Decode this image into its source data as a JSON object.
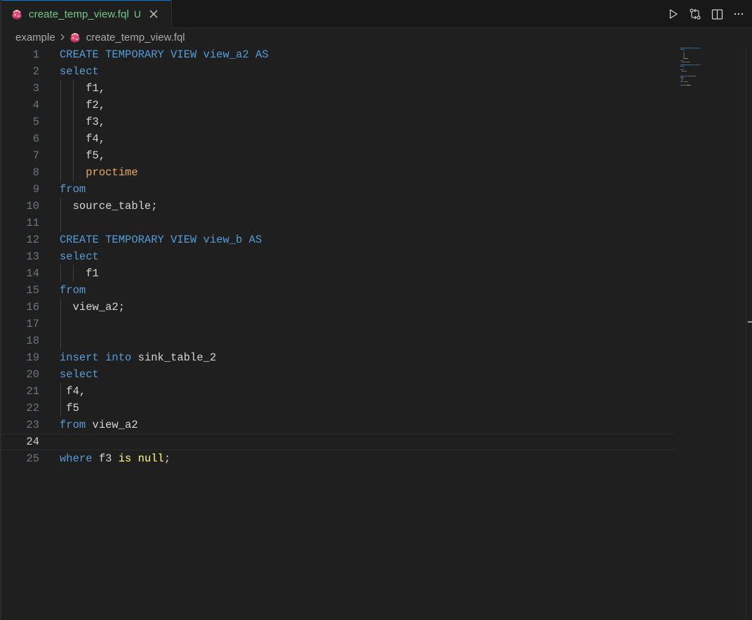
{
  "tab": {
    "filename": "create_temp_view.fql",
    "status_badge": "U",
    "icon": "fql-file-icon"
  },
  "toolbar": {
    "run_icon": "play-icon",
    "compare_icon": "git-compare-icon",
    "split_icon": "split-editor-icon",
    "more_icon": "more-actions-icon"
  },
  "breadcrumb": {
    "folder": "example",
    "file": "create_temp_view.fql"
  },
  "editor": {
    "current_line": 24,
    "lines": [
      {
        "n": "1",
        "code": [
          {
            "t": "CREATE TEMPORARY VIEW ",
            "c": "kw"
          },
          {
            "t": "view_a2",
            "c": "kw"
          },
          {
            "t": " AS",
            "c": "kw"
          }
        ]
      },
      {
        "n": "2",
        "code": [
          {
            "t": "select",
            "c": "kw"
          }
        ]
      },
      {
        "n": "3",
        "code": [
          {
            "t": "    f1,",
            "c": "id"
          }
        ]
      },
      {
        "n": "4",
        "code": [
          {
            "t": "    f2,",
            "c": "id"
          }
        ]
      },
      {
        "n": "5",
        "code": [
          {
            "t": "    f3,",
            "c": "id"
          }
        ]
      },
      {
        "n": "6",
        "code": [
          {
            "t": "    f4,",
            "c": "id"
          }
        ]
      },
      {
        "n": "7",
        "code": [
          {
            "t": "    f5,",
            "c": "id"
          }
        ]
      },
      {
        "n": "8",
        "code": [
          {
            "t": "    ",
            "c": "id"
          },
          {
            "t": "proctime",
            "c": "fn"
          }
        ]
      },
      {
        "n": "9",
        "code": [
          {
            "t": "from",
            "c": "kw"
          }
        ]
      },
      {
        "n": "10",
        "code": [
          {
            "t": "  source_table;",
            "c": "id"
          }
        ]
      },
      {
        "n": "11",
        "code": []
      },
      {
        "n": "12",
        "code": [
          {
            "t": "CREATE TEMPORARY VIEW ",
            "c": "kw"
          },
          {
            "t": "view_b",
            "c": "kw"
          },
          {
            "t": " AS",
            "c": "kw"
          }
        ]
      },
      {
        "n": "13",
        "code": [
          {
            "t": "select",
            "c": "kw"
          }
        ]
      },
      {
        "n": "14",
        "code": [
          {
            "t": "    f1",
            "c": "id"
          }
        ]
      },
      {
        "n": "15",
        "code": [
          {
            "t": "from",
            "c": "kw"
          }
        ]
      },
      {
        "n": "16",
        "code": [
          {
            "t": "  view_a2;",
            "c": "id"
          }
        ]
      },
      {
        "n": "17",
        "code": []
      },
      {
        "n": "18",
        "code": []
      },
      {
        "n": "19",
        "code": [
          {
            "t": "insert",
            "c": "kw"
          },
          {
            "t": " ",
            "c": "id"
          },
          {
            "t": "into",
            "c": "kw"
          },
          {
            "t": " sink_table_2",
            "c": "id"
          }
        ]
      },
      {
        "n": "20",
        "code": [
          {
            "t": "select",
            "c": "kw"
          }
        ]
      },
      {
        "n": "21",
        "code": [
          {
            "t": " f4,",
            "c": "id"
          }
        ]
      },
      {
        "n": "22",
        "code": [
          {
            "t": " f5",
            "c": "id"
          }
        ]
      },
      {
        "n": "23",
        "code": [
          {
            "t": "from",
            "c": "kw"
          },
          {
            "t": " view_a2",
            "c": "id"
          }
        ]
      },
      {
        "n": "24",
        "code": []
      },
      {
        "n": "25",
        "code": [
          {
            "t": "where",
            "c": "kw"
          },
          {
            "t": " f3 ",
            "c": "id"
          },
          {
            "t": "is null",
            "c": "yl"
          },
          {
            "t": ";",
            "c": "id"
          }
        ]
      }
    ]
  }
}
